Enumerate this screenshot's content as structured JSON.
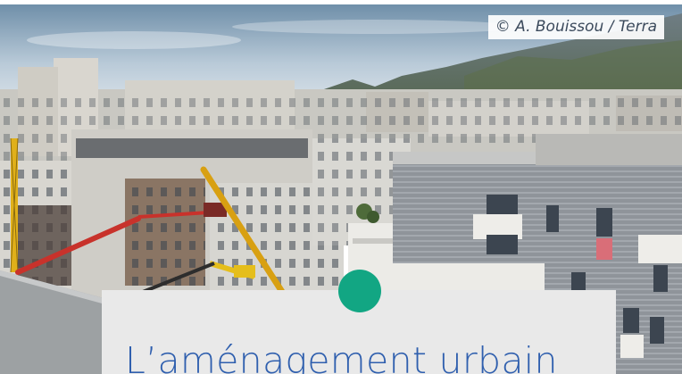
{
  "photo": {
    "credit": "© A. Bouissou / Terra",
    "subject": "urban-construction-site-with-cranes-and-mountains"
  },
  "card": {
    "title": "L’aménagement urbain",
    "accent_color": "#12a683",
    "title_color": "#2f5fae"
  }
}
